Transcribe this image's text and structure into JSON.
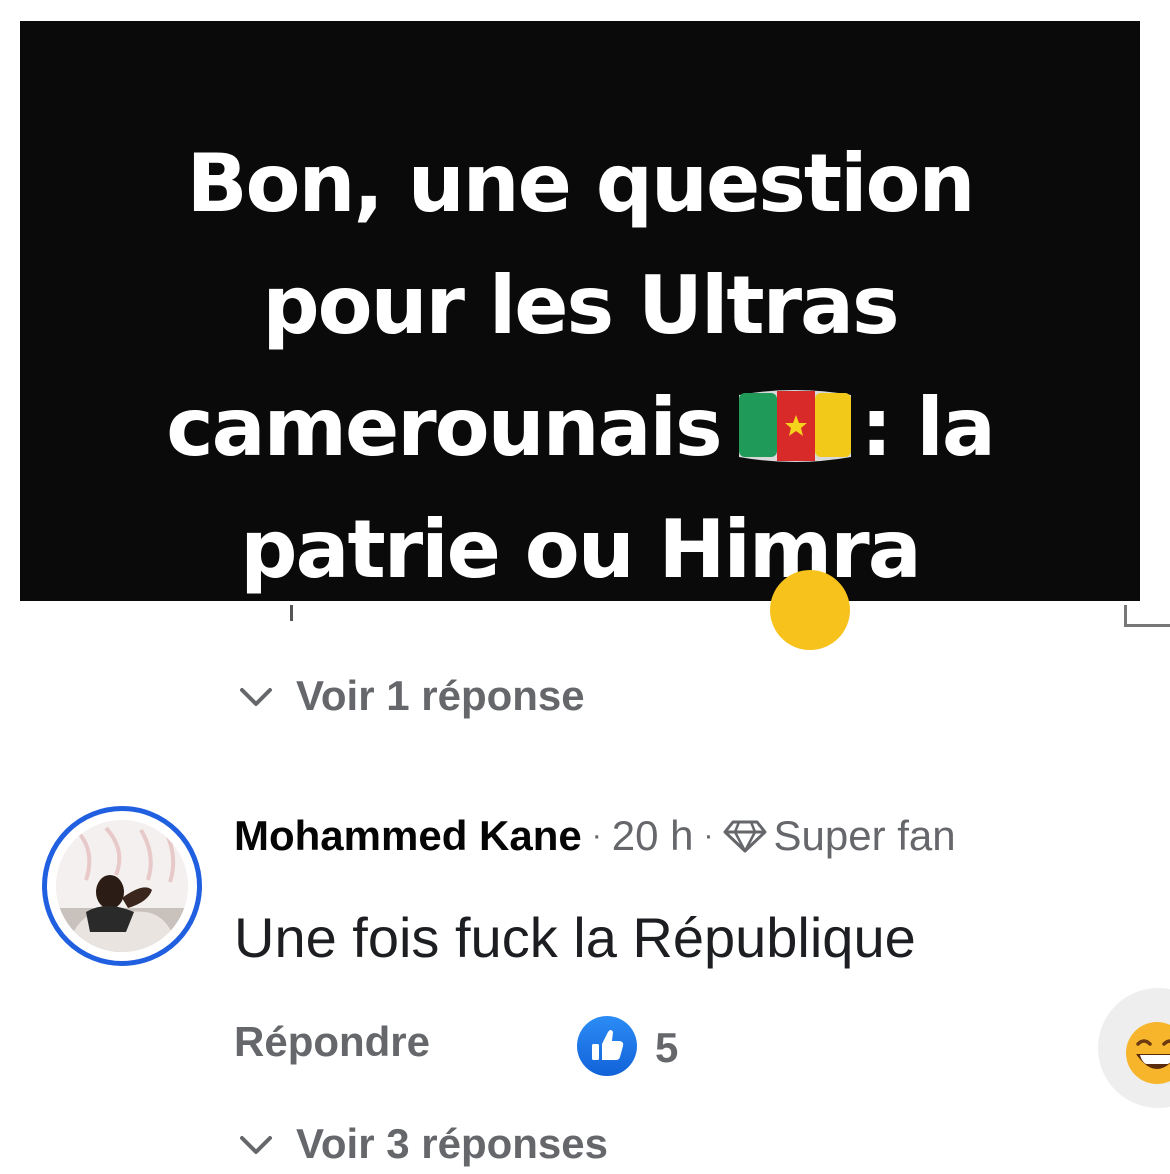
{
  "post": {
    "line1": "Bon, une question",
    "line2": "pour les Ultras",
    "line3_before_flag": "camerounais",
    "line3_after_flag": ": la",
    "line4": "patrie ou Himra",
    "flag_icon": "cameroon-flag-icon",
    "background_color": "#0a0a0a",
    "text_color": "#ffffff"
  },
  "replies_top": {
    "label": "Voir 1 réponse",
    "icon": "chevron-down-icon"
  },
  "comment": {
    "author": "Mohammed Kane",
    "separator": "·",
    "time": "20 h",
    "badge_icon": "diamond-icon",
    "badge": "Super fan",
    "text": "Une fois fuck la République",
    "reply_label": "Répondre",
    "like_icon": "like-thumb-icon",
    "like_count": "5",
    "reaction_icon": "laughing-emoji-icon",
    "avatar_ring_color": "#1f5fe0"
  },
  "replies_bottom": {
    "label": "Voir 3 réponses",
    "icon": "chevron-down-icon"
  }
}
